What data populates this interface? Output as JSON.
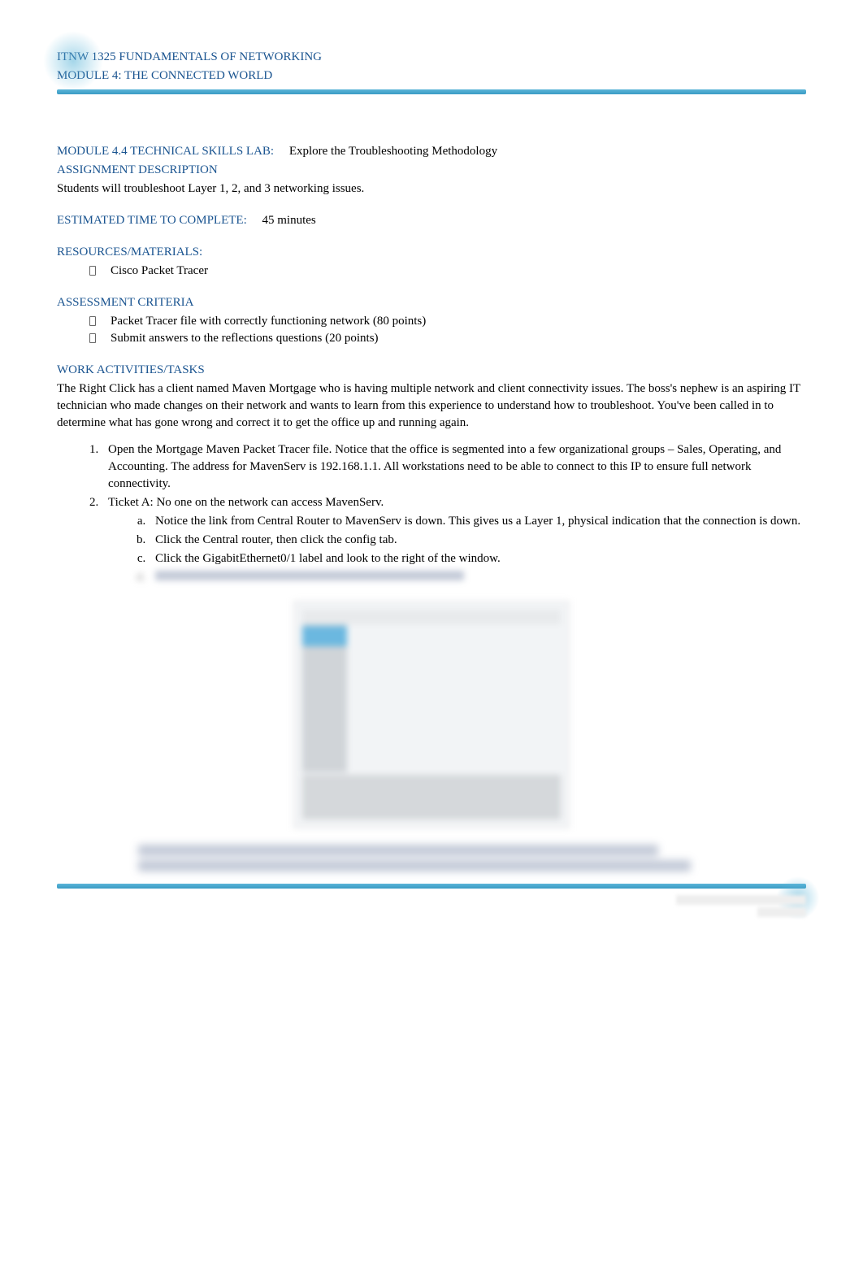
{
  "header": {
    "course": "ITNW 1325 FUNDAMENTALS OF NETWORKING",
    "module": "MODULE 4: THE CONNECTED WORLD"
  },
  "lab_title": {
    "label": "MODULE 4.4 TECHNICAL SKILLS LAB:",
    "value": "Explore the Troubleshooting Methodology"
  },
  "assignment_desc": {
    "label": "ASSIGNMENT DESCRIPTION",
    "text": "Students will troubleshoot Layer 1, 2, and 3 networking issues."
  },
  "time": {
    "label": "ESTIMATED TIME TO COMPLETE:",
    "value": "45 minutes"
  },
  "resources": {
    "label": "RESOURCES/MATERIALS:",
    "items": [
      "Cisco Packet Tracer"
    ]
  },
  "assessment": {
    "label": "ASSESSMENT CRITERIA",
    "items": [
      "Packet Tracer file with correctly functioning network (80 points)",
      "Submit answers to the reflections questions (20 points)"
    ]
  },
  "work": {
    "label": "WORK ACTIVITIES/TASKS",
    "intro": "The Right Click has a client named Maven Mortgage who is having multiple network and client connectivity issues. The boss's nephew is an aspiring IT technician who made changes on their network and wants to learn from this experience to understand how to troubleshoot. You've been called in to determine what has gone wrong and correct it to get the office up and running again.",
    "steps": [
      "Open the Mortgage Maven Packet Tracer file. Notice that the office is segmented into a few organizational groups – Sales, Operating, and Accounting. The address for MavenServ is 192.168.1.1. All workstations need to be able to connect to this IP to ensure full network connectivity.",
      "Ticket A: No one on the network can access MavenServ."
    ],
    "substeps": [
      "Notice the link from Central Router to MavenServ is down. This gives us a Layer 1, physical indication that the connection is down.",
      "Click the Central router, then click the config tab.",
      "Click the GigabitEthernet0/1 label and look to the right of the window."
    ]
  }
}
